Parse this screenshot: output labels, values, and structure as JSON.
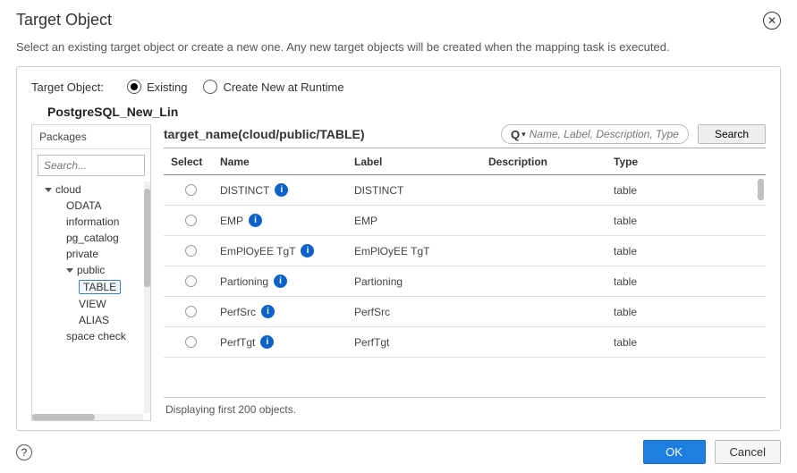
{
  "dialog": {
    "title": "Target Object",
    "description": "Select an existing target object or create a new one. Any new target objects will be created when the mapping task is executed."
  },
  "options": {
    "label": "Target Object:",
    "existing": "Existing",
    "createNew": "Create New at Runtime",
    "selected": "existing"
  },
  "connection": {
    "name": "PostgreSQL_New_Lin"
  },
  "packages": {
    "heading": "Packages",
    "searchPlaceholder": "Search...",
    "tree": [
      {
        "label": "cloud",
        "level": 1,
        "expanded": true
      },
      {
        "label": "ODATA",
        "level": 2
      },
      {
        "label": "information",
        "level": 2
      },
      {
        "label": "pg_catalog",
        "level": 2
      },
      {
        "label": "private",
        "level": 2
      },
      {
        "label": "public",
        "level": 2,
        "expanded": true
      },
      {
        "label": "TABLE",
        "level": 3,
        "selected": true
      },
      {
        "label": "VIEW",
        "level": 3
      },
      {
        "label": "ALIAS",
        "level": 3
      },
      {
        "label": "space check",
        "level": 2
      }
    ]
  },
  "objects": {
    "path": "target_name(cloud/public/TABLE)",
    "searchPlaceholder": "Name, Label, Description, Type",
    "searchButton": "Search",
    "columns": {
      "select": "Select",
      "name": "Name",
      "label": "Label",
      "desc": "Description",
      "type": "Type"
    },
    "rows": [
      {
        "name": "DISTINCT",
        "label": "DISTINCT",
        "desc": "",
        "type": "table"
      },
      {
        "name": "EMP",
        "label": "EMP",
        "desc": "",
        "type": "table"
      },
      {
        "name": "EmPlOyEE TgT",
        "label": "EmPlOyEE TgT",
        "desc": "",
        "type": "table"
      },
      {
        "name": "Partioning",
        "label": "Partioning",
        "desc": "",
        "type": "table"
      },
      {
        "name": "PerfSrc",
        "label": "PerfSrc",
        "desc": "",
        "type": "table"
      },
      {
        "name": "PerfTgt",
        "label": "PerfTgt",
        "desc": "",
        "type": "table"
      }
    ],
    "footer": "Displaying first 200 objects."
  },
  "buttons": {
    "ok": "OK",
    "cancel": "Cancel"
  }
}
